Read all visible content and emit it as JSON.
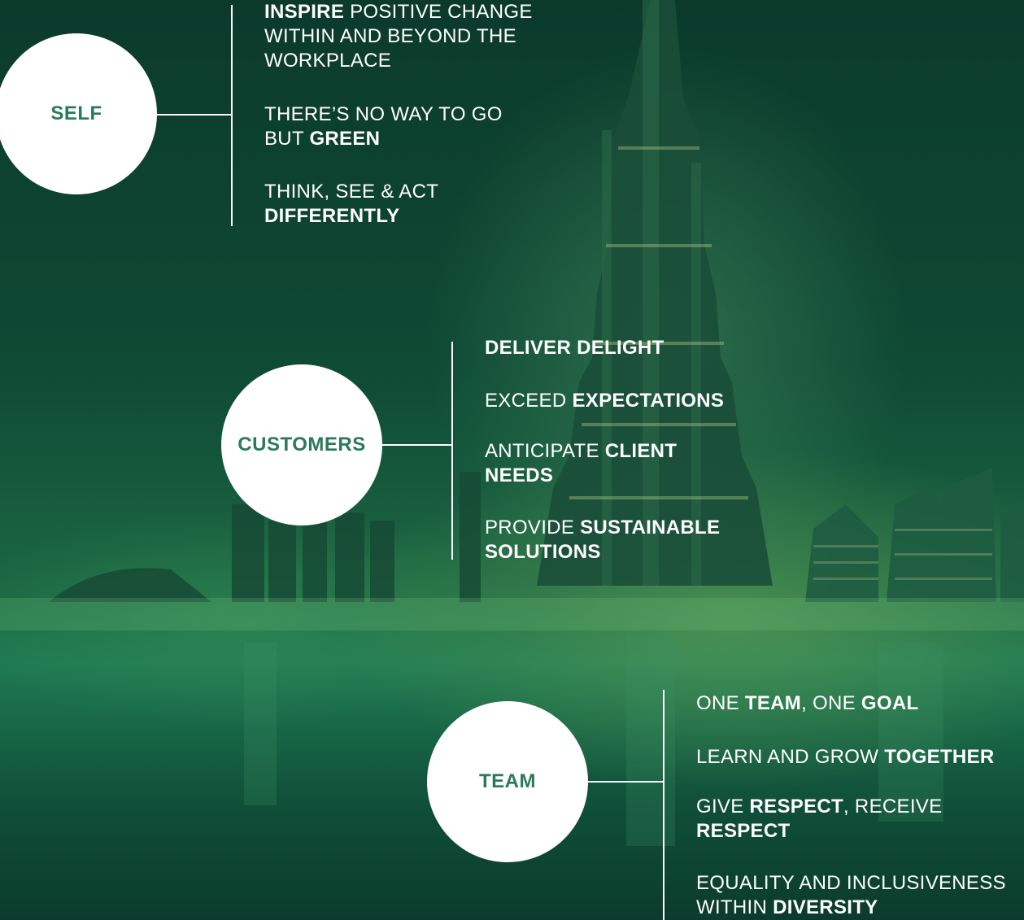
{
  "groups": [
    {
      "id": "self",
      "title": "SELF",
      "items": [
        [
          {
            "t": "INSPIRE",
            "b": true
          },
          {
            "t": " POSITIVE CHANGE WITHIN AND BEYOND THE WORKPLACE",
            "b": false
          }
        ],
        [
          {
            "t": "THERE’S NO WAY TO GO BUT ",
            "b": false
          },
          {
            "t": "GREEN",
            "b": true
          }
        ],
        [
          {
            "t": "THINK, SEE & ACT ",
            "b": false
          },
          {
            "t": "DIFFERENTLY",
            "b": true
          }
        ]
      ]
    },
    {
      "id": "customers",
      "title": "CUSTOMERS",
      "items": [
        [
          {
            "t": "DELIVER DELIGHT",
            "b": true
          }
        ],
        [
          {
            "t": "EXCEED ",
            "b": false
          },
          {
            "t": "EXPECTATIONS",
            "b": true
          }
        ],
        [
          {
            "t": "ANTICIPATE ",
            "b": false
          },
          {
            "t": "CLIENT NEEDS",
            "b": true
          }
        ],
        [
          {
            "t": "PROVIDE ",
            "b": false
          },
          {
            "t": "SUSTAINABLE SOLUTIONS",
            "b": true
          }
        ]
      ]
    },
    {
      "id": "team",
      "title": "TEAM",
      "items": [
        [
          {
            "t": "ONE ",
            "b": false
          },
          {
            "t": "TEAM",
            "b": true
          },
          {
            "t": ", ONE ",
            "b": false
          },
          {
            "t": "GOAL",
            "b": true
          }
        ],
        [
          {
            "t": "LEARN AND GROW ",
            "b": false
          },
          {
            "t": "TOGETHER",
            "b": true
          }
        ],
        [
          {
            "t": "GIVE ",
            "b": false
          },
          {
            "t": "RESPECT",
            "b": true
          },
          {
            "t": ", RECEIVE ",
            "b": false
          },
          {
            "t": "RESPECT",
            "b": true
          }
        ],
        [
          {
            "t": "EQUALITY AND INCLUSIVENESS WITHIN ",
            "b": false
          },
          {
            "t": "DIVERSITY",
            "b": true
          }
        ]
      ]
    }
  ],
  "colors": {
    "circle_text": "#2a7a58",
    "background": "#0c3b2c",
    "text": "#ffffff"
  }
}
